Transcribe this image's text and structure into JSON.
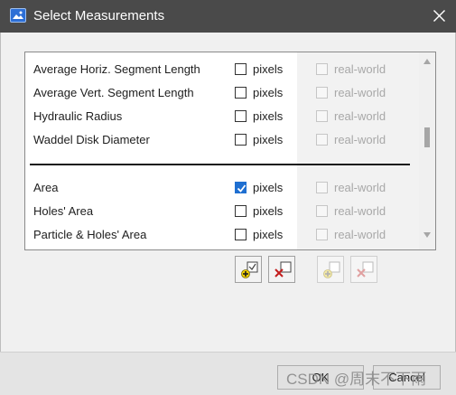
{
  "window": {
    "title": "Select Measurements",
    "icon": "image-icon",
    "close_icon": "close-icon"
  },
  "columns": {
    "pixels_label": "pixels",
    "real_world_label": "real-world"
  },
  "rows_top": [
    {
      "label": "Average Horiz. Segment Length",
      "pixels_checked": false,
      "real_world_checked": false,
      "real_world_enabled": false
    },
    {
      "label": "Average Vert. Segment Length",
      "pixels_checked": false,
      "real_world_checked": false,
      "real_world_enabled": false
    },
    {
      "label": "Hydraulic Radius",
      "pixels_checked": false,
      "real_world_checked": false,
      "real_world_enabled": false
    },
    {
      "label": "Waddel Disk Diameter",
      "pixels_checked": false,
      "real_world_checked": false,
      "real_world_enabled": false
    }
  ],
  "rows_bottom": [
    {
      "label": "Area",
      "pixels_checked": true,
      "real_world_checked": false,
      "real_world_enabled": false
    },
    {
      "label": "Holes' Area",
      "pixels_checked": false,
      "real_world_checked": false,
      "real_world_enabled": false
    },
    {
      "label": "Particle & Holes' Area",
      "pixels_checked": false,
      "real_world_checked": false,
      "real_world_enabled": false
    }
  ],
  "toolbar": {
    "pixels_select_all_icon": "select-all-icon",
    "pixels_clear_all_icon": "clear-all-icon",
    "realworld_select_all_icon": "select-all-icon",
    "realworld_clear_all_icon": "clear-all-icon"
  },
  "footer": {
    "ok_label": "OK",
    "cancel_label": "Cancel"
  },
  "watermark": "CSDN @周末不下雨",
  "colors": {
    "titlebar": "#4a4a4a",
    "check_accent": "#1f6fd1"
  }
}
